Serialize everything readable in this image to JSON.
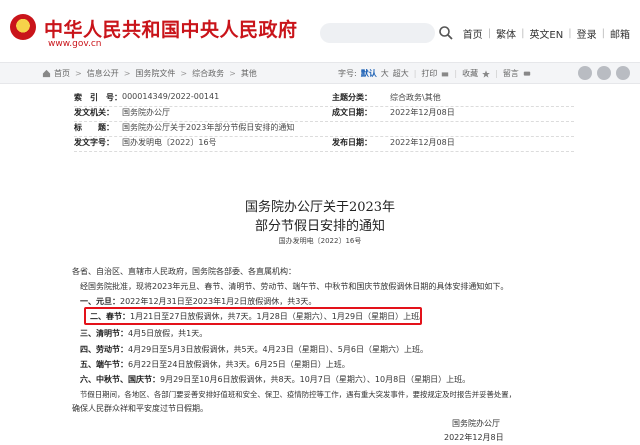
{
  "header": {
    "site_title": "中华人民共和国中央人民政府",
    "site_url": "www.gov.cn",
    "nav": [
      "首页",
      "繁体",
      "英文EN",
      "登录",
      "邮箱"
    ]
  },
  "breadcrumb": [
    "首页",
    "信息公开",
    "国务院文件",
    "综合政务",
    "其他"
  ],
  "toolbar": {
    "font_label": "字号:",
    "font_sizes": [
      "默认",
      "大",
      "超大"
    ],
    "print": "打印",
    "favorite": "收藏",
    "leave": "留言",
    "share_icons": [
      "weibo-icon",
      "wechat-icon",
      "qq-icon"
    ]
  },
  "meta": [
    {
      "label": "索　引　号：",
      "value": "000014349/2022-00141",
      "label2": "主题分类：",
      "value2": "综合政务\\其他"
    },
    {
      "label": "发文机关：",
      "value": "国务院办公厅",
      "label2": "成文日期：",
      "value2": "2022年12月08日"
    },
    {
      "label": "标　　题：",
      "value": "国务院办公厅关于2023年部分节假日安排的通知",
      "label2": "",
      "value2": ""
    },
    {
      "label": "发文字号：",
      "value": "国办发明电〔2022〕16号",
      "label2": "发布日期：",
      "value2": "2022年12月08日"
    }
  ],
  "document": {
    "title_line1": "国务院办公厅关于2023年",
    "title_line2": "部分节假日安排的通知",
    "doc_number": "国办发明电〔2022〕16号",
    "addressee": "各省、自治区、直辖市人民政府，国务院各部委、各直属机构：",
    "intro": "经国务院批准，现将2023年元旦、春节、清明节、劳动节、端午节、中秋节和国庆节放假调休日期的具体安排通知如下。",
    "holidays": [
      {
        "name": "一、元旦：",
        "text": "2022年12月31日至2023年1月2日放假调休，共3天。"
      },
      {
        "name": "二、春节：",
        "text": "1月21日至27日放假调休，共7天。1月28日（星期六）、1月29日（星期日）上班。"
      },
      {
        "name": "三、清明节：",
        "text": "4月5日放假，共1天。"
      },
      {
        "name": "四、劳动节：",
        "text": "4月29日至5月3日放假调休，共5天。4月23日（星期日）、5月6日（星期六）上班。"
      },
      {
        "name": "五、端午节：",
        "text": "6月22日至24日放假调休，共3天。6月25日（星期日）上班。"
      },
      {
        "name": "六、中秋节、国庆节：",
        "text": "9月29日至10月6日放假调休，共8天。10月7日（星期六）、10月8日（星期日）上班。"
      }
    ],
    "closing_line1": "节假日期间，各地区、各部门要妥善安排好值班和安全、保卫、疫情防控等工作，遇有重大突发事件，要按规定及时报告并妥善处置，",
    "closing_line2": "确保人民群众祥和平安度过节日假期。",
    "signer": "国务院办公厅",
    "sign_date": "2022年12月8日"
  }
}
